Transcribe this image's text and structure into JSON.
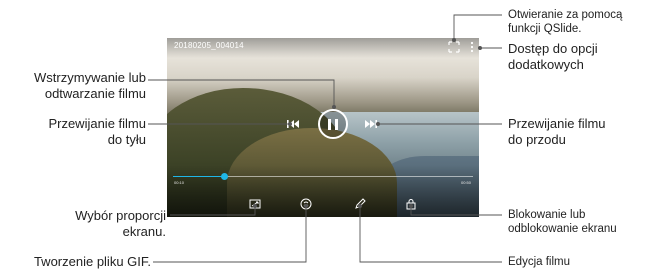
{
  "video": {
    "filename": "20180205_004014",
    "progress_fraction": 0.17,
    "time_elapsed": "00:10",
    "time_total": "00:50"
  },
  "callouts": {
    "pause_play": "Wstrzymywanie lub\nodtwarzanie filmu",
    "rewind": "Przewijanie filmu\ndo tyłu",
    "aspect_ratio": "Wybór proporcji\nekranu.",
    "gif": "Tworzenie pliku GIF.",
    "qslide": "Otwieranie za pomocą\nfunkcji QSlide.",
    "more_options": "Dostęp do opcji\ndodatkowych",
    "forward": "Przewijanie filmu\ndo przodu",
    "lock": "Blokowanie lub\nodblokowanie ekranu",
    "edit": "Edycja filmu"
  },
  "icons": {
    "qslide": "qslide-icon",
    "more": "more-options-icon",
    "pause": "pause-icon",
    "rewind": "rewind-icon",
    "forward": "fast-forward-icon",
    "aspect": "aspect-ratio-icon",
    "gif": "gif-icon",
    "edit": "edit-pencil-icon",
    "lock": "lock-icon"
  },
  "colors": {
    "progress": "#1fb6e6",
    "leader_line": "#555555"
  }
}
